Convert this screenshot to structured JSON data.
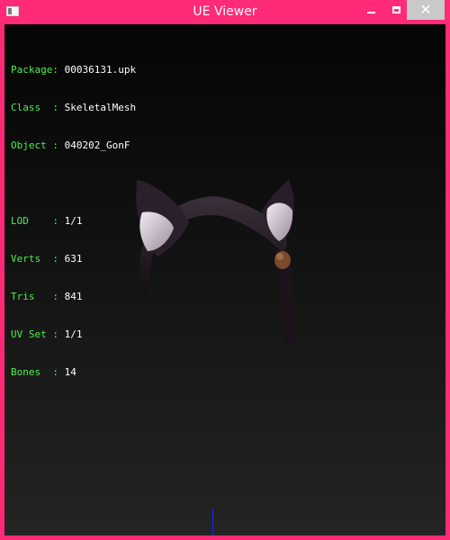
{
  "window": {
    "title": "UE Viewer",
    "icons": {
      "app": "app-icon",
      "minimize": "minimize-icon",
      "maximize": "maximize-icon",
      "close": "close-icon"
    }
  },
  "info": {
    "package": {
      "label": "Package:",
      "value": "00036131.upk"
    },
    "class": {
      "label": "Class  :",
      "value": "SkeletalMesh"
    },
    "object": {
      "label": "Object :",
      "value": "040202_GonF"
    },
    "lod": {
      "label": "LOD    :",
      "value": "1/1"
    },
    "verts": {
      "label": "Verts  :",
      "value": "631"
    },
    "tris": {
      "label": "Tris   :",
      "value": "841"
    },
    "uvset": {
      "label": "UV Set :",
      "value": "1/1"
    },
    "bones": {
      "label": "Bones  :",
      "value": "14"
    }
  },
  "colors": {
    "titlebar": "#ff2a78",
    "label_text": "#4cf04c",
    "value_text": "#ffffff",
    "axis": "#2020ff"
  }
}
